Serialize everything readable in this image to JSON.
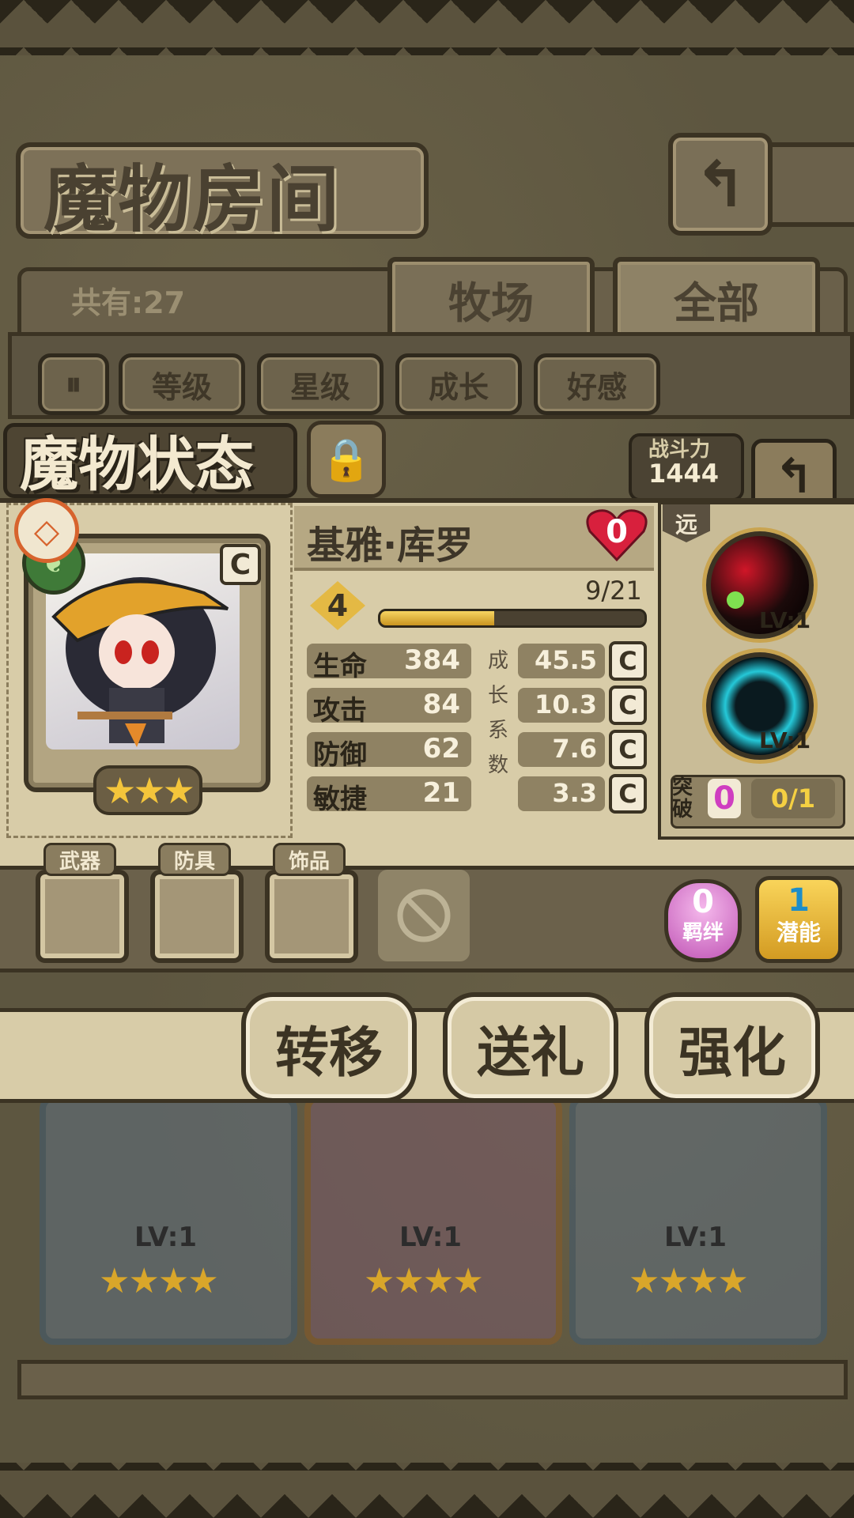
{
  "header": {
    "title": "魔物房间"
  },
  "list": {
    "count_label": "共有:27"
  },
  "tabs": [
    {
      "label": "牧场"
    },
    {
      "label": "全部"
    }
  ],
  "filters": [
    {
      "label": "等级"
    },
    {
      "label": "星级"
    },
    {
      "label": "成长"
    },
    {
      "label": "好感"
    }
  ],
  "status": {
    "title": "魔物状态",
    "power_label": "战斗力",
    "power_value": "1444"
  },
  "monster": {
    "name": "基雅·库罗",
    "favor": "0",
    "level": "4",
    "exp_text": "9/21",
    "exp_fraction": 0.43,
    "grade": "C",
    "stars": "★★★",
    "range": "远",
    "stats": [
      {
        "name": "生命",
        "value": "384",
        "growth": "45.5",
        "grade": "C"
      },
      {
        "name": "攻击",
        "value": "84",
        "growth": "10.3",
        "grade": "C"
      },
      {
        "name": "防御",
        "value": "62",
        "growth": "7.6",
        "grade": "C"
      },
      {
        "name": "敏捷",
        "value": "21",
        "growth": "3.3",
        "grade": "C"
      }
    ],
    "growth_label": [
      "成",
      "长",
      "系",
      "数"
    ],
    "skills": [
      {
        "level": "LV:1"
      },
      {
        "level": "LV:1"
      }
    ],
    "breakthrough": {
      "label": "突破",
      "count": "0",
      "progress": "0/1"
    }
  },
  "equipment": {
    "weapon": "武器",
    "armor": "防具",
    "accessory": "饰品"
  },
  "bond": {
    "count": "0",
    "label": "羁绊"
  },
  "potential": {
    "count": "1",
    "label": "潜能"
  },
  "actions": {
    "transfer": "转移",
    "gift": "送礼",
    "enhance": "强化"
  },
  "grid": [
    {
      "level": "LV:1"
    },
    {
      "level": "LV:1"
    },
    {
      "level": "LV:1"
    }
  ],
  "grid_stars": "★★★★",
  "colors": {
    "accent_gold": "#f4c53b",
    "bond_pink": "#cf3ec0",
    "frame_dark": "#3b3323"
  }
}
